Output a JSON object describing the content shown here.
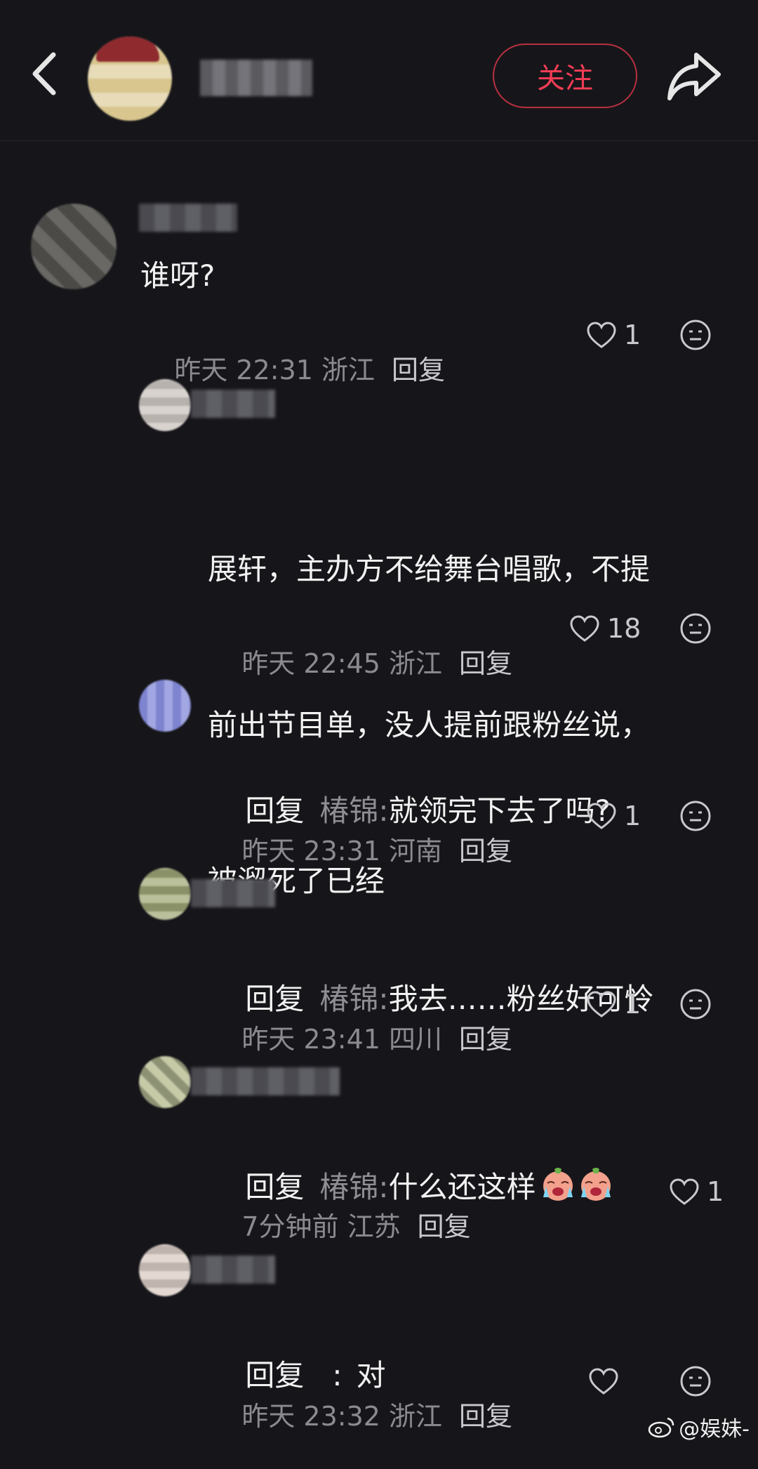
{
  "header": {
    "follow_label": "关注"
  },
  "comments": [
    {
      "text": "谁呀?",
      "time": "昨天 22:31",
      "location": "浙江",
      "reply_label": "回复",
      "likes": "1"
    },
    {
      "text_lines": [
        "展轩，主办方不给舞台唱歌，不提",
        "前出节目单，没人提前跟粉丝说，",
        "被溜死了已经"
      ],
      "time": "昨天 22:45",
      "location": "浙江",
      "reply_label": "回复",
      "likes": "18"
    },
    {
      "prefix": "回复",
      "target": "椿锦:",
      "text": "就领完下去了吗?",
      "time": "昨天 23:31",
      "location": "河南",
      "reply_label": "回复",
      "likes": "1"
    },
    {
      "prefix": "回复",
      "target": "椿锦:",
      "text": "我去……粉丝好可怜",
      "time": "昨天 23:41",
      "location": "四川",
      "reply_label": "回复",
      "likes": "1"
    },
    {
      "prefix": "回复",
      "target": "椿锦:",
      "text": "什么还这样",
      "time": "7分钟前",
      "location": "江苏",
      "reply_label": "回复",
      "likes": "1"
    },
    {
      "prefix": "回复",
      "target": ":",
      "text": "对",
      "time": "昨天 23:32",
      "location": "浙江",
      "reply_label": "回复",
      "likes": ""
    }
  ],
  "watermark": "@娱妹-",
  "icons": {
    "back": "back-arrow-icon",
    "share": "share-icon",
    "like": "heart-icon",
    "emoji": "emoji-icon",
    "cry_emoji": "crying-face-emoji"
  },
  "colors": {
    "background": "#16161a",
    "follow_accent": "#f23d55"
  }
}
